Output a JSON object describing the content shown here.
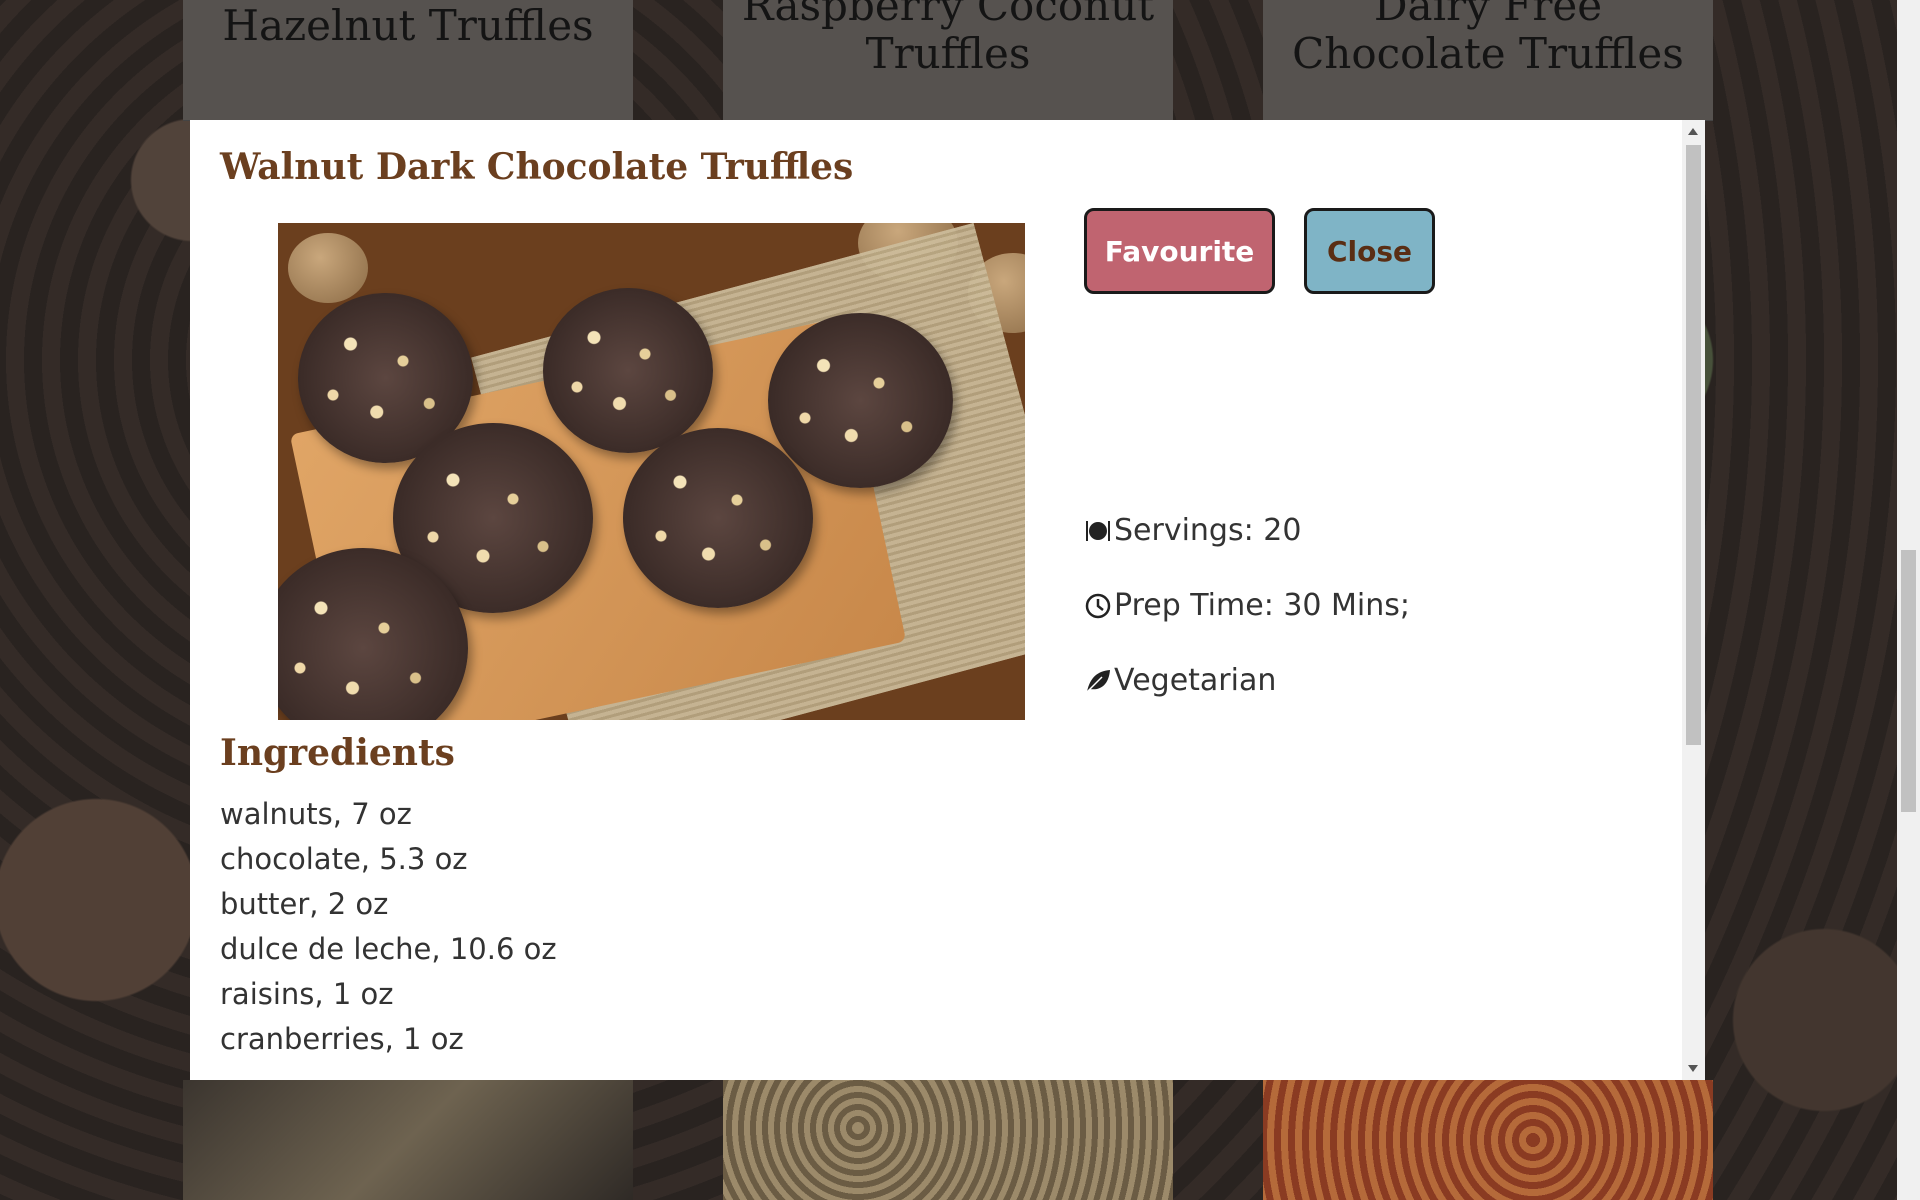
{
  "background_cards": [
    {
      "title": "Hazelnut Truffles"
    },
    {
      "title": "Raspberry Coconut Truffles"
    },
    {
      "title": "Dairy Free Chocolate Truffles"
    }
  ],
  "modal": {
    "title": "Walnut Dark Chocolate Truffles",
    "buttons": {
      "favourite": "Favourite",
      "close": "Close"
    },
    "meta": {
      "servings": "Servings: 20",
      "prep_time": "Prep Time: 30 Mins;",
      "diet": "Vegetarian"
    },
    "icons": {
      "servings": "plate-cutlery-icon",
      "prep_time": "clock-icon",
      "diet": "leaf-icon"
    },
    "ingredients_heading": "Ingredients",
    "ingredients": [
      "walnuts, 7 oz",
      "chocolate, 5.3 oz",
      "butter, 2 oz",
      "dulce de leche, 10.6 oz",
      "raisins, 1 oz",
      "cranberries, 1 oz"
    ]
  },
  "colors": {
    "heading": "#6b3f1f",
    "favourite_button": "#c06470",
    "close_button": "#7fb4c6",
    "close_text": "#5a2e14"
  }
}
